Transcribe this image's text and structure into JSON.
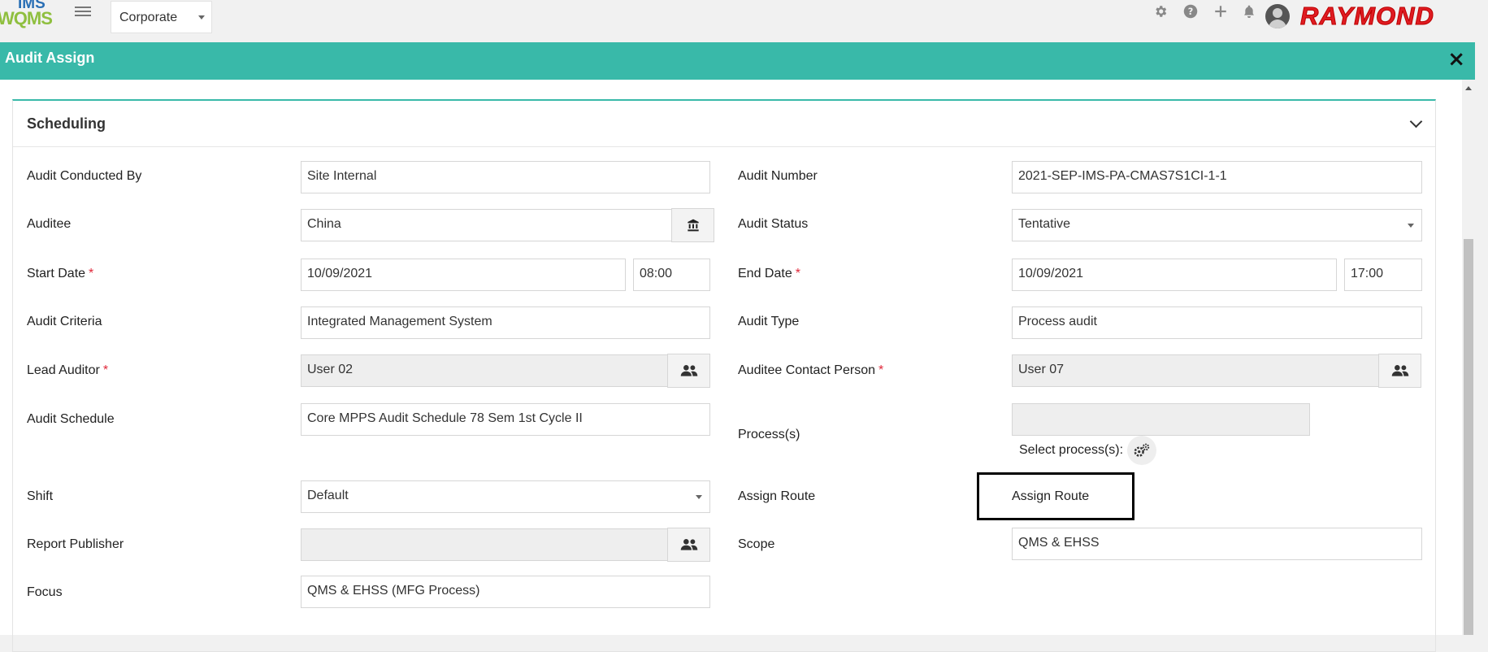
{
  "topbar": {
    "logo_top": "IMS",
    "logo_bottom": "WQMS",
    "org_select": "Corporate",
    "brand": "RAYMOND"
  },
  "modal": {
    "title": "Audit Assign",
    "close": "×"
  },
  "panel": {
    "title": "Scheduling"
  },
  "form": {
    "audit_conducted_by": {
      "label": "Audit Conducted By",
      "value": "Site Internal"
    },
    "audit_number": {
      "label": "Audit Number",
      "value": "2021-SEP-IMS-PA-CMAS7S1CI-1-1"
    },
    "auditee": {
      "label": "Auditee",
      "value": "China"
    },
    "audit_status": {
      "label": "Audit Status",
      "value": "Tentative"
    },
    "start_date": {
      "label": "Start Date",
      "date": "10/09/2021",
      "time": "08:00"
    },
    "end_date": {
      "label": "End Date",
      "date": "10/09/2021",
      "time": "17:00"
    },
    "audit_criteria": {
      "label": "Audit Criteria",
      "value": "Integrated Management System"
    },
    "audit_type": {
      "label": "Audit Type",
      "value": "Process audit"
    },
    "lead_auditor": {
      "label": "Lead Auditor",
      "value": "User 02"
    },
    "auditee_contact": {
      "label": "Auditee Contact Person",
      "value": "User 07"
    },
    "audit_schedule": {
      "label": "Audit Schedule",
      "value": "Core MPPS Audit Schedule 78 Sem 1st Cycle II"
    },
    "processes": {
      "label": "Process(s)",
      "value": "",
      "select_label": "Select process(s):"
    },
    "shift": {
      "label": "Shift",
      "value": "Default"
    },
    "assign_route": {
      "label": "Assign Route",
      "button": "Assign Route"
    },
    "report_publisher": {
      "label": "Report Publisher",
      "value": ""
    },
    "scope": {
      "label": "Scope",
      "value": "QMS & EHSS"
    },
    "focus": {
      "label": "Focus",
      "value": "QMS & EHSS (MFG Process)"
    },
    "required_mark": "*"
  },
  "colors": {
    "header": "#39b9a9",
    "required": "#e0283a",
    "brand": "#e01c22"
  }
}
